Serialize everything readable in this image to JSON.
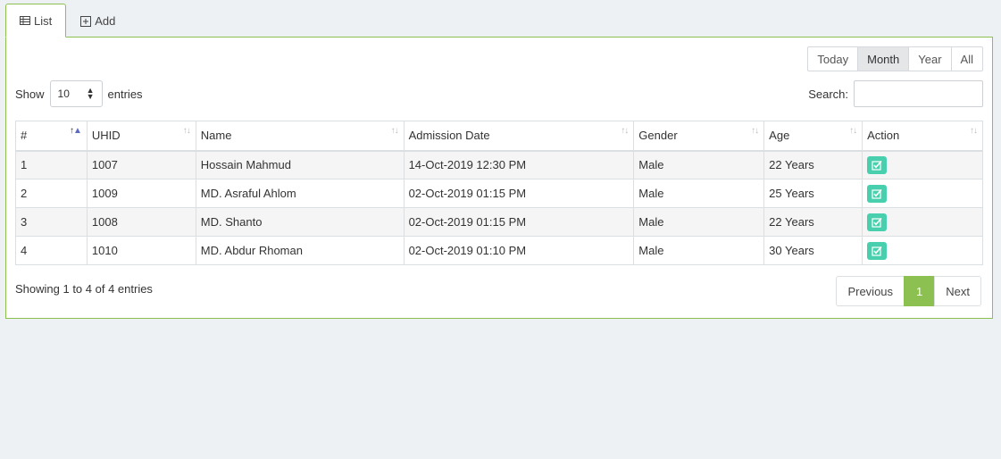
{
  "tabs": [
    {
      "label": "List",
      "icon": "table-icon",
      "active": true
    },
    {
      "label": "Add",
      "icon": "plus-square-icon",
      "active": false
    }
  ],
  "period_filters": [
    {
      "label": "Today",
      "active": false
    },
    {
      "label": "Month",
      "active": true
    },
    {
      "label": "Year",
      "active": false
    },
    {
      "label": "All",
      "active": false
    }
  ],
  "length": {
    "prefix": "Show",
    "value": "10",
    "suffix": "entries"
  },
  "search": {
    "label": "Search:",
    "value": ""
  },
  "table": {
    "columns": [
      "#",
      "UHID",
      "Name",
      "Admission Date",
      "Gender",
      "Age",
      "Action"
    ],
    "rows": [
      {
        "index": "1",
        "uhid": "1007",
        "name": "Hossain Mahmud",
        "admission_date": "14-Oct-2019 12:30 PM",
        "gender": "Male",
        "age": "22 Years"
      },
      {
        "index": "2",
        "uhid": "1009",
        "name": "MD. Asraful Ahlom",
        "admission_date": "02-Oct-2019 01:15 PM",
        "gender": "Male",
        "age": "25 Years"
      },
      {
        "index": "3",
        "uhid": "1008",
        "name": "MD. Shanto",
        "admission_date": "02-Oct-2019 01:15 PM",
        "gender": "Male",
        "age": "22 Years"
      },
      {
        "index": "4",
        "uhid": "1010",
        "name": "MD. Abdur Rhoman",
        "admission_date": "02-Oct-2019 01:10 PM",
        "gender": "Male",
        "age": "30 Years"
      }
    ]
  },
  "info": "Showing 1 to 4 of 4 entries",
  "pagination": {
    "previous": "Previous",
    "current": "1",
    "next": "Next"
  },
  "colors": {
    "accent": "#8cc152",
    "action": "#48cfad"
  }
}
